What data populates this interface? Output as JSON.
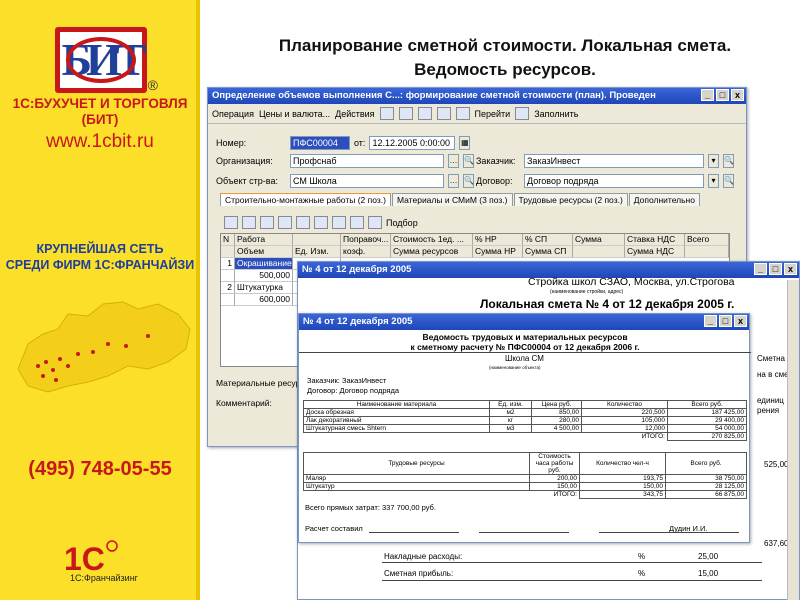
{
  "brand": {
    "logo_text": "БИТ",
    "reg": "®",
    "name_line1": "1С:БУХУЧЕТ И ТОРГОВЛЯ",
    "name_line2": "(БИТ)",
    "site": "www.1cbit.ru",
    "network_line1": "КРУПНЕЙШАЯ СЕТЬ",
    "network_line2": "СРЕДИ ФИРМ 1С:ФРАНЧАЙЗИ",
    "phone": "(495) 748-05-55",
    "c1_logo": "1С",
    "c1_text": "1С:Франчайзинг",
    "colors": {
      "yellow": "#fcdf28",
      "red": "#c8171b",
      "blue": "#1f3f9a"
    }
  },
  "slide": {
    "title_line1": "Планирование сметной стоимости. Локальная смета.",
    "title_line2": "Ведомость ресурсов."
  },
  "window_main": {
    "title": "Определение объемов выполнения С...: формирование сметной стоимости (план). Проведен",
    "controls": [
      "_",
      "□",
      "x"
    ],
    "toolbar": {
      "operation": "Операция",
      "prices": "Цены и валюта...",
      "actions": "Действия",
      "goto": "Перейти",
      "fill": "Заполнить"
    },
    "fields": {
      "number_label": "Номер:",
      "number_value": "ПФС00004",
      "date_label": "от:",
      "date_value": "12.12.2005  0:00:00",
      "org_label": "Организация:",
      "org_value": "Профснаб",
      "customer_label": "Заказчик:",
      "customer_value": "ЗаказИнвест",
      "object_label": "Объект стр-ва:",
      "object_value": "СМ Школа",
      "contract_label": "Договор:",
      "contract_value": "Договор подряда"
    },
    "tabs": [
      "Строительно-монтажные работы (2 поз.)",
      "Материалы и СМиМ (3 поз.)",
      "Трудовые ресурсы (2 поз.)",
      "Дополнительно"
    ],
    "grid_toolbar": {
      "selection": "Подбор"
    },
    "grid": {
      "headers1": [
        "N",
        "Работа",
        "Поправоч...",
        "Стоимость 1ед. ...",
        "% НР",
        "% СП",
        "Сумма",
        "Ставка НДС",
        "Всего"
      ],
      "headers2": [
        "",
        "Объем",
        "Ед. Изм.",
        "коэф.",
        "Сумма ресурсов",
        "Сумма НР",
        "Сумма СП",
        "",
        "Сумма НДС",
        ""
      ],
      "rows": [
        {
          "n": "1",
          "work": "Окрашивание",
          "volume": "500,000"
        },
        {
          "n": "2",
          "work": "Штукатурка",
          "volume": "600,000"
        }
      ]
    },
    "materials_label": "Материальные ресурсы",
    "comment_label": "Комментарий:"
  },
  "window_doc": {
    "title": "№ 4 от 12 декабря 2005",
    "address": "Стройка школ СЗАО, Москва, ул.Строгова",
    "address_sub": "(наименование стройки, адрес)",
    "estimate_title": "Локальная смета № 4 от 12 декабря 2005 г.",
    "right_cells": [
      "Сметна",
      "на в сме",
      "единиц",
      "рения",
      "525,00",
      "637,60"
    ],
    "bottom_rows": [
      {
        "name": "Накладные расходы:",
        "unit": "%",
        "value": "25,00"
      },
      {
        "name": "Сметная прибыль:",
        "unit": "%",
        "value": "15,00"
      }
    ]
  },
  "window_report": {
    "title": "№ 4 от 12 декабря 2005",
    "heading1": "Ведомость трудовых и материальных ресурсов",
    "heading2": "к сметному расчету № ПФС00004 от 12 декабря 2006 г.",
    "object": "Школа СМ",
    "object_sub": "(наименование объекта)",
    "customer": "Заказчик: ЗаказИнвест",
    "contract": "Договор: Договор подряда",
    "materials_headers": [
      "Наименование материала",
      "Ед. изм.",
      "Цена руб.",
      "Количество",
      "Всего руб."
    ],
    "materials": [
      [
        "Доска обрезная",
        "м2",
        "850,00",
        "220,500",
        "187 425,00"
      ],
      [
        "Лак декоративный",
        "кг",
        "280,00",
        "105,000",
        "29 400,00"
      ],
      [
        "Штукатурная смесь Shtern",
        "м3",
        "4 500,00",
        "12,000",
        "54 000,00"
      ]
    ],
    "materials_total_label": "ИТОГО:",
    "materials_total": "270 825,00",
    "labor_headers": [
      "Трудовые ресурсы",
      "Стоимость часа работы руб.",
      "Количество чел-ч",
      "Всего руб."
    ],
    "labor": [
      [
        "Маляр",
        "200,00",
        "193,75",
        "38 750,00"
      ],
      [
        "Штукатур",
        "150,00",
        "150,00",
        "28 125,00"
      ]
    ],
    "labor_total_label": "ИТОГО:",
    "labor_total_qty": "343,75",
    "labor_total": "66 875,00",
    "direct_costs": "Всего прямых затрат: 337 700,00 руб.",
    "composed": "Расчет составил",
    "signature": "Дудин И.И."
  }
}
